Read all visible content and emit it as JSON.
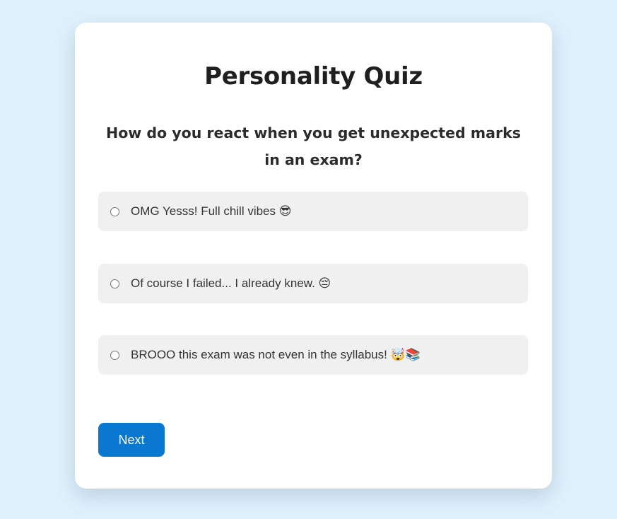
{
  "quiz": {
    "title": "Personality Quiz",
    "question": "How do you react when you get unexpected marks in an exam?",
    "options": [
      {
        "label": "OMG Yesss! Full chill vibes 😎",
        "selected": false
      },
      {
        "label": "Of course I failed... I already knew. 😔",
        "selected": false
      },
      {
        "label": "BROOO this exam was not even in the syllabus! 🤯📚",
        "selected": false
      }
    ],
    "next_label": "Next"
  },
  "colors": {
    "background": "#dff1fc",
    "card": "#ffffff",
    "option_bg": "#f0f0f0",
    "accent": "#0a78d1"
  }
}
